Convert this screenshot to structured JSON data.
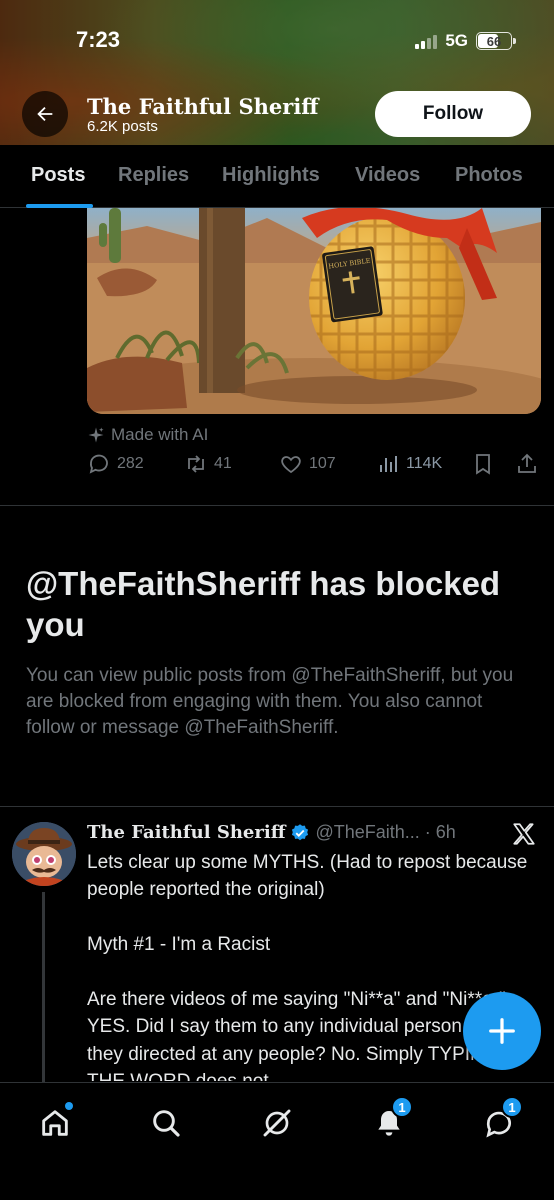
{
  "status_bar": {
    "time": "7:23",
    "network": "5G",
    "battery": "66",
    "battery_percent": 66
  },
  "header": {
    "profile_name": "The Faithful Sheriff",
    "post_count": "6.2K posts",
    "follow_label": "Follow"
  },
  "tabs": [
    {
      "label": "Posts",
      "active": true
    },
    {
      "label": "Replies",
      "active": false
    },
    {
      "label": "Highlights",
      "active": false
    },
    {
      "label": "Videos",
      "active": false
    },
    {
      "label": "Photos",
      "active": false
    }
  ],
  "post": {
    "image_bible_text": "HOLY BIBLE",
    "ai_label": "Made with AI",
    "replies": "282",
    "reposts": "41",
    "likes": "107",
    "views": "114K"
  },
  "blocked": {
    "title": "@TheFaithSheriff has blocked you",
    "description": "You can view public posts from @TheFaithSheriff, but you are blocked from engaging with them. You also cannot follow or message @TheFaithSheriff."
  },
  "tweet": {
    "author": "The Faithful Sheriff",
    "handle": "@TheFaith...",
    "separator": "·",
    "time": "6h",
    "text": "Lets clear up some MYTHS. (Had to repost because people reported the original)\n\nMyth #1 - I'm a Racist\n\nAre there videos of me saying \"Ni**a\" and \"Ni**er\". YES. Did I say them to any individual person or were they directed at any people? No. Simply TYPING THE WORD does not"
  },
  "bottom_nav": {
    "items": [
      {
        "icon": "home-icon",
        "has_dot": true
      },
      {
        "icon": "search-icon"
      },
      {
        "icon": "grok-icon"
      },
      {
        "icon": "notifications-icon",
        "badge": "1"
      },
      {
        "icon": "messages-icon",
        "badge": "1"
      }
    ]
  },
  "colors": {
    "accent": "#1d9bf0",
    "background": "#000000",
    "secondary_text": "#71767b",
    "divider": "#2f3336"
  }
}
